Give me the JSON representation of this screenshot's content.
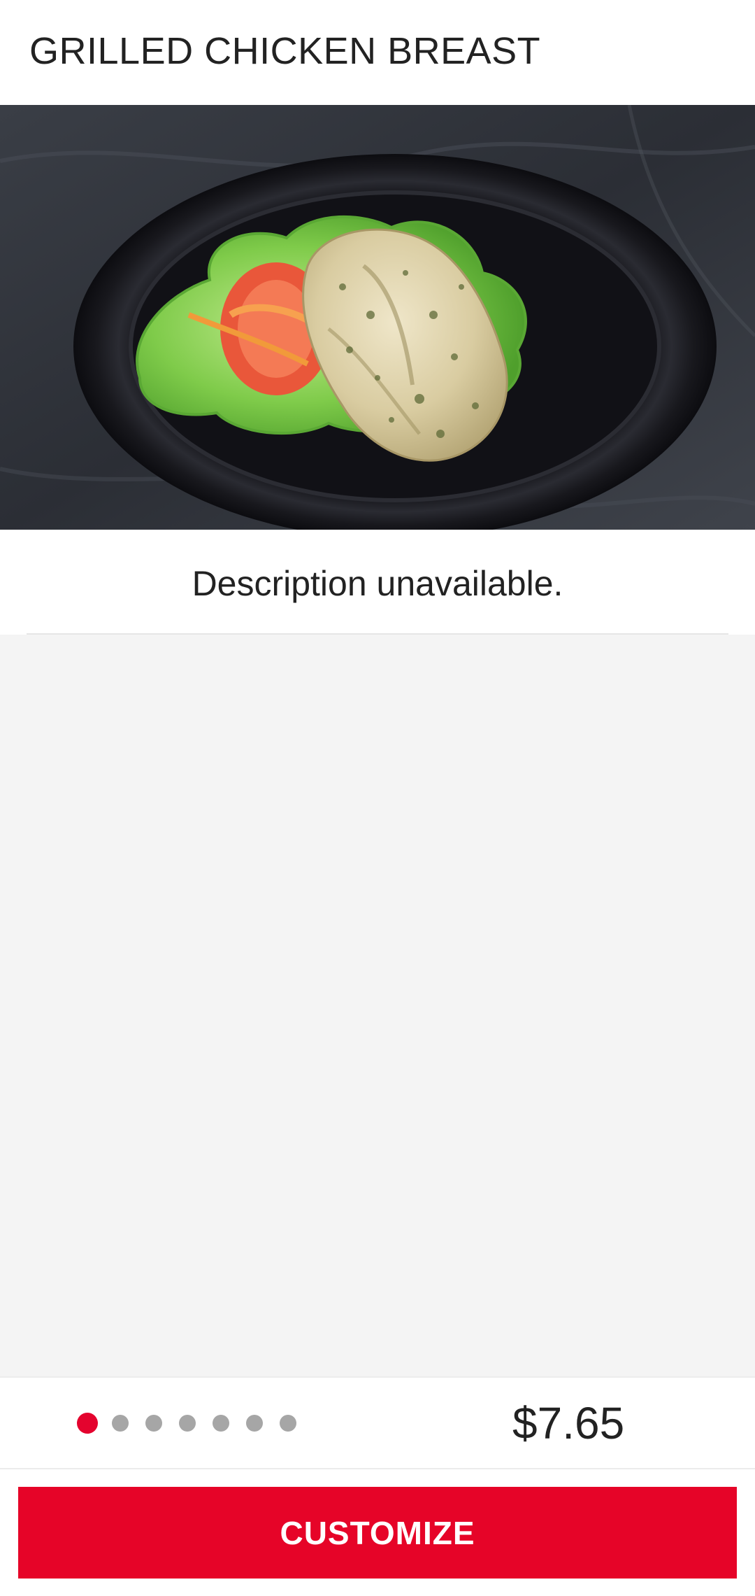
{
  "header": {
    "title": "GRILLED CHICKEN BREAST"
  },
  "hero": {
    "image_alt": "Grilled chicken breast on lettuce and tomato on a black plate"
  },
  "item": {
    "description": "Description unavailable.",
    "price": "$7.65"
  },
  "pager": {
    "total_pages": 7,
    "active_index": 0,
    "active_color": "#e4032e",
    "inactive_color": "#a6a6a6"
  },
  "actions": {
    "customize_label": "CUSTOMIZE",
    "customize_color": "#e60428"
  }
}
